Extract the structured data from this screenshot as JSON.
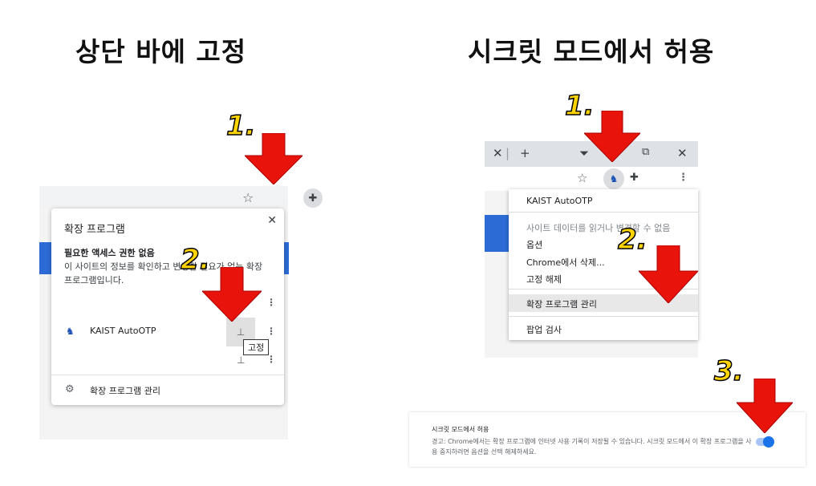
{
  "headings": {
    "left": "상단 바에 고정",
    "right": "시크릿 모드에서 허용"
  },
  "steps": {
    "left_1": "1.",
    "left_2": "2.",
    "right_1": "1.",
    "right_2": "2.",
    "right_3": "3."
  },
  "colors": {
    "arrow": "#e8140c",
    "step_label": "#ffd400",
    "accent_blue": "#1a73e8"
  },
  "left_panel": {
    "toolbar_icons": [
      "star-icon",
      "puzzle-icon"
    ],
    "popup": {
      "title": "확장 프로그램",
      "close_icon": "close-icon",
      "section_heading": "필요한 액세스 권한 없음",
      "section_desc": "이 사이트의 정보를 확인하고 변경할 필요가 없는 확장 프로그램입니다.",
      "extension_name": "KAIST AutoOTP",
      "pin_tooltip": "고정",
      "manage_label": "확장 프로그램 관리"
    }
  },
  "right_panel": {
    "tabbar_icons": [
      "close-icon",
      "plus-icon",
      "dropdown-icon",
      "restore-icon",
      "close-icon"
    ],
    "context_menu": {
      "items": [
        "KAIST AutoOTP",
        "사이트 데이터를 읽거나 변경할 수 없음",
        "옵션",
        "Chrome에서 삭제...",
        "고정 해제",
        "확장 프로그램 관리",
        "팝업 검사"
      ],
      "highlighted_item": "확장 프로그램 관리"
    },
    "incognito_setting": {
      "title": "시크릿 모드에서 허용",
      "description": "경고: Chrome에서는 확장 프로그램에 인터넷 사용 기록이 저장될 수 있습니다. 시크릿 모드에서 이 확장 프로그램을 사용 중지하려면 옵션을 선택 해제하세요.",
      "enabled": true
    }
  }
}
